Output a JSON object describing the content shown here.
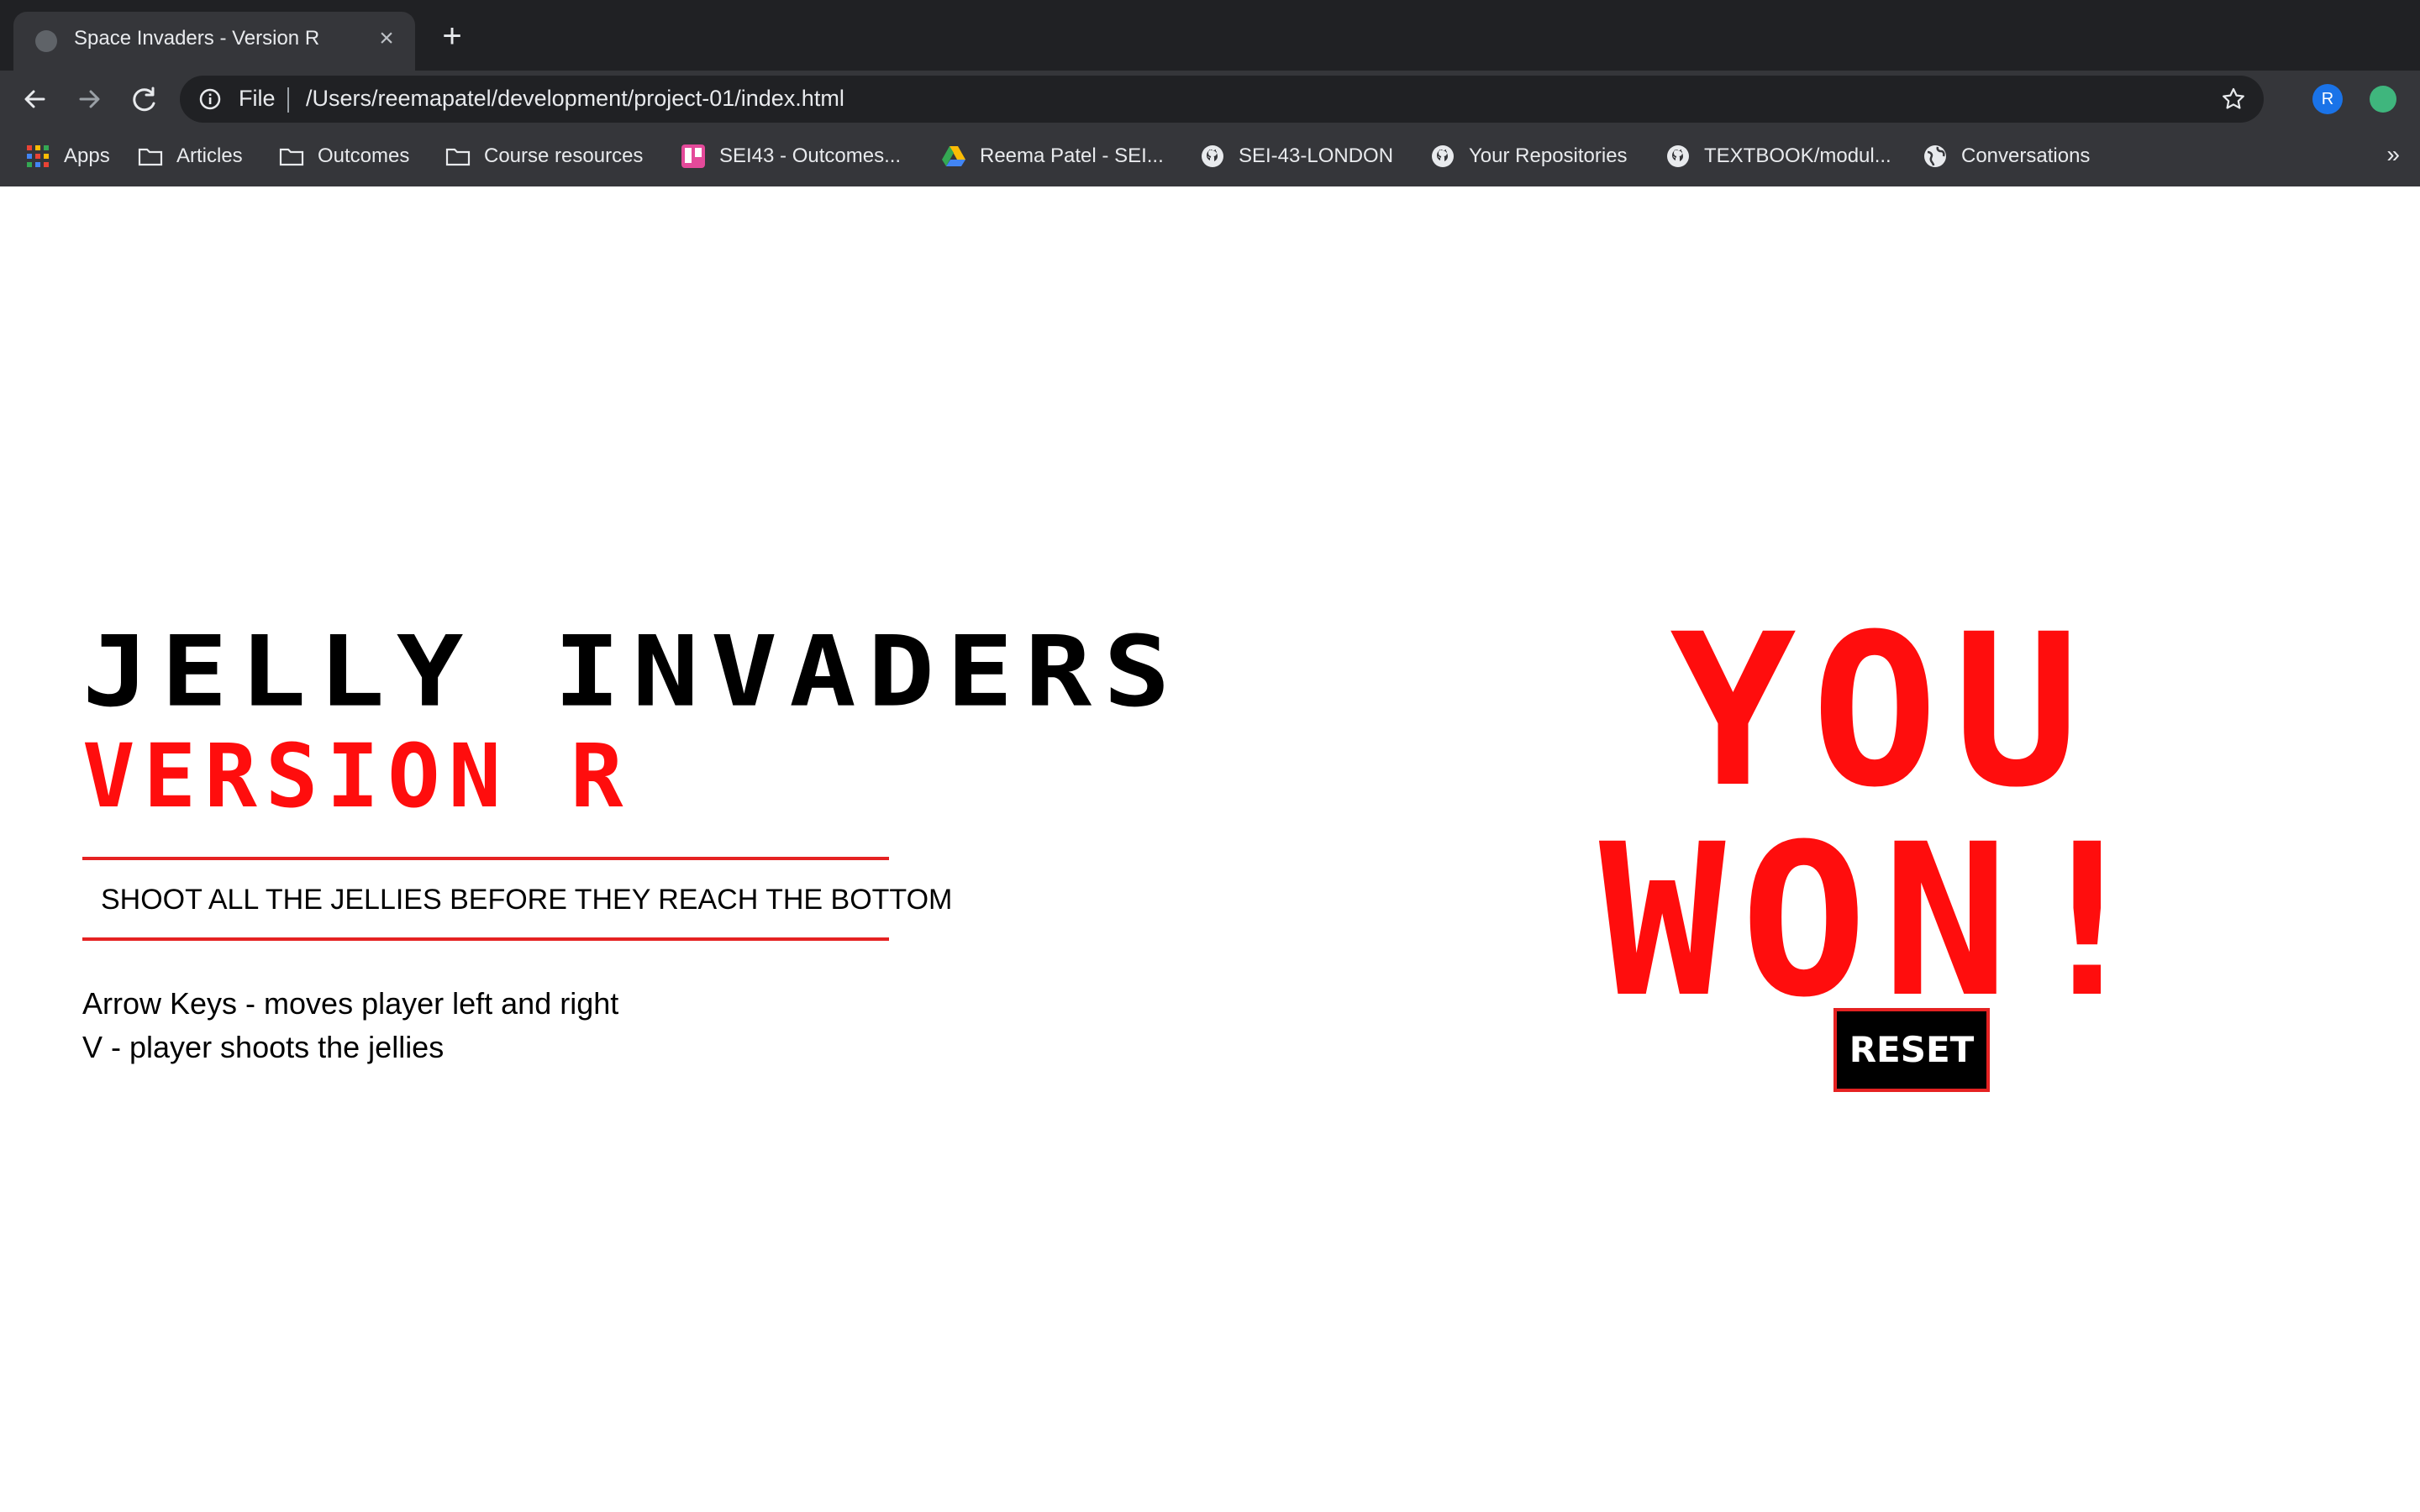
{
  "browser": {
    "tab_title": "Space Invaders - Version R",
    "url_scheme": "File",
    "url": "/Users/reemapatel/development/project-01/index.html",
    "profile_initial": "R",
    "bookmarks": [
      {
        "label": "Apps",
        "icon": "apps-grid-icon"
      },
      {
        "label": "Articles",
        "icon": "folder-icon"
      },
      {
        "label": "Outcomes",
        "icon": "folder-icon"
      },
      {
        "label": "Course resources",
        "icon": "folder-icon"
      },
      {
        "label": "SEI43 - Outcomes...",
        "icon": "trello-icon"
      },
      {
        "label": "Reema Patel - SEI...",
        "icon": "google-drive-icon"
      },
      {
        "label": "SEI-43-LONDON",
        "icon": "github-icon"
      },
      {
        "label": "Your Repositories",
        "icon": "github-icon"
      },
      {
        "label": "TEXTBOOK/modul...",
        "icon": "github-icon"
      },
      {
        "label": "Conversations",
        "icon": "globe-icon"
      }
    ],
    "more_label": "»"
  },
  "game": {
    "title": "JELLY INVADERS",
    "version": "VERSION R",
    "tagline": "SHOOT ALL THE JELLIES BEFORE THEY REACH THE BOTTOM",
    "instructions": [
      "Arrow Keys - moves player left and right",
      "V - player shoots the jellies"
    ],
    "result_line1": "YOU",
    "result_line2": "WON!",
    "reset_label": "RESET"
  },
  "colors": {
    "accent_red": "#ff0d0d",
    "chrome_dark": "#202124",
    "chrome_toolbar": "#35363a"
  }
}
